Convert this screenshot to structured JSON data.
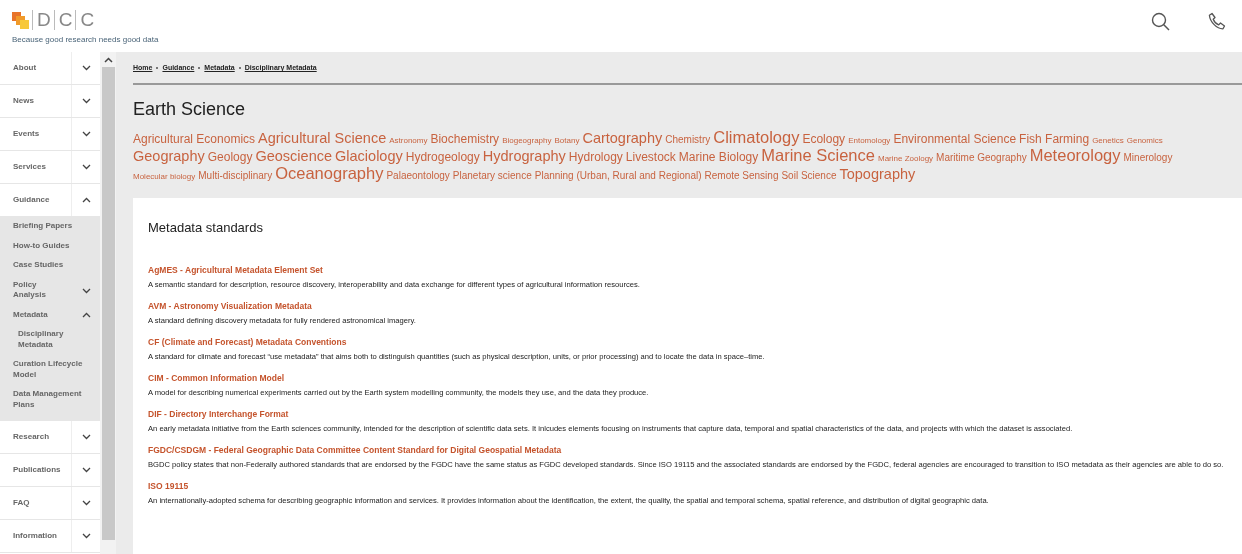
{
  "header": {
    "logo_letters": [
      "D",
      "C",
      "C"
    ],
    "tagline": "Because good research needs good data"
  },
  "sidebar": {
    "items": [
      {
        "label": "About",
        "expanded": false
      },
      {
        "label": "News",
        "expanded": false
      },
      {
        "label": "Events",
        "expanded": false
      },
      {
        "label": "Services",
        "expanded": false
      },
      {
        "label": "Guidance",
        "expanded": true,
        "children": [
          {
            "label": "Briefing Papers"
          },
          {
            "label": "How-to Guides"
          },
          {
            "label": "Case Studies"
          },
          {
            "label": "Policy Analysis",
            "expanded": false
          },
          {
            "label": "Metadata",
            "expanded": true,
            "children": [
              {
                "label": "Disciplinary Metadata"
              }
            ]
          },
          {
            "label": "Curation Lifecycle Model"
          },
          {
            "label": "Data Management Plans"
          }
        ]
      },
      {
        "label": "Research",
        "expanded": false
      },
      {
        "label": "Publications",
        "expanded": false
      },
      {
        "label": "FAQ",
        "expanded": false
      },
      {
        "label": "Information",
        "expanded": false
      }
    ]
  },
  "breadcrumb": [
    "Home",
    "Guidance",
    "Metadata",
    "Disciplinary Metadata"
  ],
  "title": "Earth Science",
  "tags": [
    {
      "label": "Agricultural Economics",
      "kind": "m"
    },
    {
      "label": "Agricultural Science",
      "kind": "l"
    },
    {
      "label": "Astronomy",
      "kind": "xs"
    },
    {
      "label": "Biochemistry",
      "kind": "m"
    },
    {
      "label": "Biogeography",
      "kind": "xs"
    },
    {
      "label": "Botany",
      "kind": "xs"
    },
    {
      "label": "Cartography",
      "kind": "l"
    },
    {
      "label": "Chemistry",
      "kind": "s"
    },
    {
      "label": "Climatology",
      "kind": "xl"
    },
    {
      "label": "Ecology",
      "kind": "m"
    },
    {
      "label": "Entomology",
      "kind": "xs"
    },
    {
      "label": "Environmental Science",
      "kind": "m"
    },
    {
      "label": "Fish Farming",
      "kind": "m"
    },
    {
      "label": "Genetics",
      "kind": "xs"
    },
    {
      "label": "Genomics",
      "kind": "xs"
    },
    {
      "label": "Geography",
      "kind": "l"
    },
    {
      "label": "Geology",
      "kind": "m"
    },
    {
      "label": "Geoscience",
      "kind": "l"
    },
    {
      "label": "Glaciology",
      "kind": "l"
    },
    {
      "label": "Hydrogeology",
      "kind": "m"
    },
    {
      "label": "Hydrography",
      "kind": "l"
    },
    {
      "label": "Hydrology",
      "kind": "m"
    },
    {
      "label": "Livestock",
      "kind": "m"
    },
    {
      "label": "Marine Biology",
      "kind": "m"
    },
    {
      "label": "Marine Science",
      "kind": "xl"
    },
    {
      "label": "Marine Zoology",
      "kind": "xs"
    },
    {
      "label": "Maritime Geography",
      "kind": "s"
    },
    {
      "label": "Meteorology",
      "kind": "xl"
    },
    {
      "label": "Minerology",
      "kind": "s"
    },
    {
      "label": "Molecular biology",
      "kind": "xs"
    },
    {
      "label": "Multi-disciplinary",
      "kind": "s"
    },
    {
      "label": "Oceanography",
      "kind": "xl"
    },
    {
      "label": "Palaeontology",
      "kind": "s"
    },
    {
      "label": "Planetary science",
      "kind": "s"
    },
    {
      "label": "Planning (Urban, Rural and Regional)",
      "kind": "s"
    },
    {
      "label": "Remote Sensing",
      "kind": "s"
    },
    {
      "label": "Soil Science",
      "kind": "s"
    },
    {
      "label": "Topography",
      "kind": "l"
    }
  ],
  "standards": {
    "heading": "Metadata standards",
    "items": [
      {
        "title": "AgMES - Agricultural Metadata Element Set",
        "description": "A semantic standard for description, resource discovery, interoperability and data exchange for different types of agricultural information resources."
      },
      {
        "title": "AVM - Astronomy Visualization Metadata",
        "description": "A standard defining discovery metadata for fully rendered astronomical imagery."
      },
      {
        "title": "CF (Climate and Forecast) Metadata Conventions",
        "description": "A standard for climate and forecast “use metadata” that aims both to distinguish quantities (such as physical description, units, or prior processing) and to locate the data in space–time."
      },
      {
        "title": "CIM - Common Information Model",
        "description": "A model for describing numerical experiments carried out by the Earth system modelling community, the models they use, and the data they produce."
      },
      {
        "title": "DIF - Directory Interchange Format",
        "description": "An early metadata initiative from the Earth sciences community, intended for the description of scientific data sets. It inlcudes elements focusing on instruments that capture data, temporal and spatial characteristics of the data, and projects with which the dataset is associated."
      },
      {
        "title": "FGDC/CSDGM - Federal Geographic Data Committee Content Standard for Digital Geospatial Metadata",
        "description": "BGDC policy states that non-Federally authored standards that are endorsed by the FGDC have the same status as FGDC developed standards. Since ISO 19115 and the associated standards are endorsed by the FGDC, federal agencies are encouraged to transition to ISO metadata as their agencies are able to do so."
      },
      {
        "title": "ISO 19115",
        "description": "An internationally-adopted schema for describing geographic information and services. It provides information about the identification, the extent, the quality, the spatial and temporal schema, spatial reference, and distribution of digital geographic data."
      }
    ]
  }
}
